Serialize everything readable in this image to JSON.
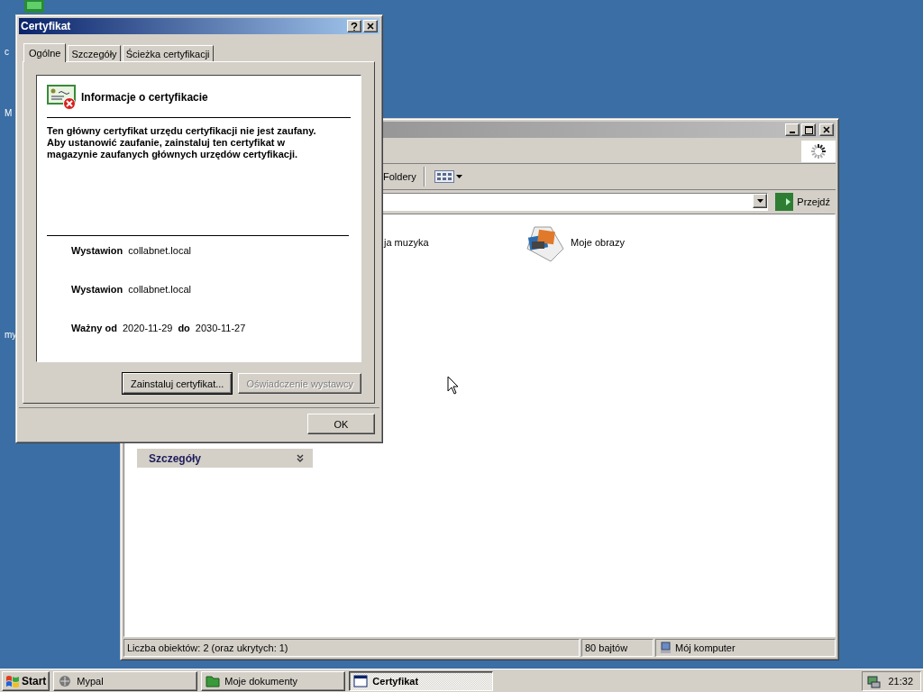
{
  "desktop_icons": [
    {
      "label": "c"
    },
    {
      "label": "M"
    },
    {
      "label": "my"
    }
  ],
  "explorer": {
    "toolbar": {
      "folders_label": "Foldery"
    },
    "address_bar": {
      "go_label": "Przejdź"
    },
    "items": [
      {
        "label": "ja muzyka"
      },
      {
        "label": "Moje obrazy"
      }
    ],
    "details_panel": {
      "title": "Szczegóły",
      "expanded": false
    },
    "status_bar": [
      "Liczba obiektów: 2 (oraz ukrytych: 1)",
      "80 bajtów",
      "Mój komputer"
    ]
  },
  "dialog": {
    "title": "Certyfikat",
    "tabs": [
      {
        "label": "Ogólne",
        "selected": true
      },
      {
        "label": "Szczegóły",
        "selected": false
      },
      {
        "label": "Ścieżka certyfikacji",
        "selected": false
      }
    ],
    "heading": "Informacje o certyfikacie",
    "message": "Ten główny certyfikat urzędu certyfikacji nie jest zaufany. Aby ustanowić zaufanie, zainstaluj ten certyfikat w magazynie zaufanych głównych urzędów certyfikacji.",
    "fields": [
      {
        "kind": "field",
        "label": "Wystawion",
        "value": "collabnet.local"
      },
      {
        "kind": "field",
        "label": "Wystawion",
        "value": "collabnet.local"
      },
      {
        "kind": "validity",
        "label": "Ważny od",
        "from": "2020-11-29",
        "to_label": "do",
        "to": "2030-11-27"
      }
    ],
    "buttons": [
      {
        "label": "Zainstaluj certyfikat...",
        "disabled": false
      },
      {
        "label": "Oświadczenie wystawcy",
        "disabled": true
      }
    ],
    "ok": "OK"
  },
  "taskbar": {
    "start": "Start",
    "tasks": [
      {
        "label": "Mypal",
        "selected": false
      },
      {
        "label": "Moje dokumenty",
        "selected": false
      },
      {
        "label": "Certyfikat",
        "selected": true
      }
    ],
    "clock": "21:32"
  }
}
